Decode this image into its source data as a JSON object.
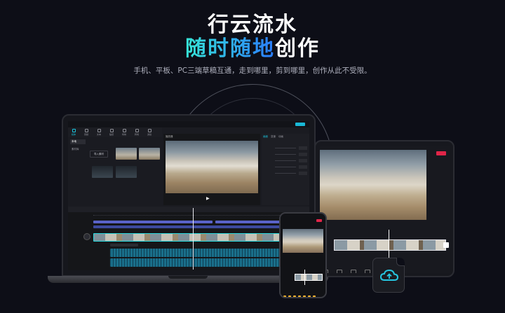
{
  "hero": {
    "title_line1": "行云流水",
    "title_line2_highlight": "随时随地",
    "title_line2_rest": "创作",
    "subtitle": "手机、平板、PC三端草稿互通，走到哪里，剪到哪里，创作从此不受限。"
  },
  "colors": {
    "background": "#0d0e17",
    "accent_gradient_start": "#36e6d8",
    "accent_gradient_end": "#2a7cff",
    "export_button_cyan": "#19b8d6",
    "export_button_red": "#e02548",
    "cloud_icon": "#26c6e0"
  },
  "laptop_editor": {
    "toolbar_tools": [
      "媒体",
      "音频",
      "文本",
      "贴纸",
      "特效",
      "转场",
      "滤镜"
    ],
    "library_side": [
      "本地",
      "素材库"
    ],
    "import_label": "导入素材",
    "player_label": "播放器",
    "property_tabs": [
      "画面",
      "变速",
      "动画"
    ]
  },
  "icons": {
    "cloud": "cloud-icon",
    "play": "play-icon"
  }
}
